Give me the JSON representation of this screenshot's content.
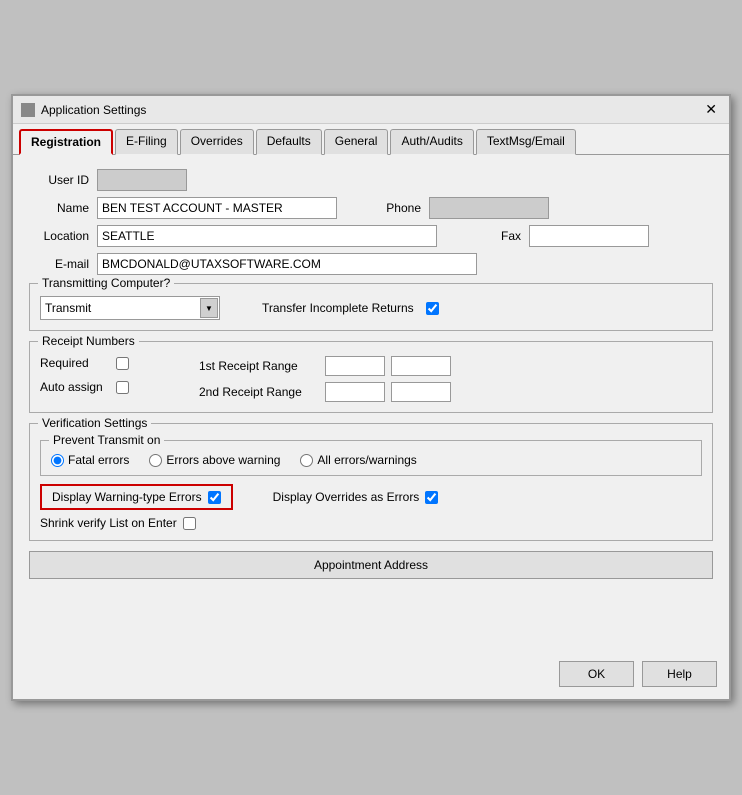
{
  "window": {
    "title": "Application Settings",
    "close_label": "✕"
  },
  "tabs": [
    {
      "id": "registration",
      "label": "Registration",
      "active": true
    },
    {
      "id": "efiling",
      "label": "E-Filing",
      "active": false
    },
    {
      "id": "overrides",
      "label": "Overrides",
      "active": false
    },
    {
      "id": "defaults",
      "label": "Defaults",
      "active": false
    },
    {
      "id": "general",
      "label": "General",
      "active": false
    },
    {
      "id": "auth-audits",
      "label": "Auth/Audits",
      "active": false
    },
    {
      "id": "textmsg-email",
      "label": "TextMsg/Email",
      "active": false
    }
  ],
  "form": {
    "userid_label": "User ID",
    "userid_value": "",
    "name_label": "Name",
    "name_value": "BEN TEST ACCOUNT - MASTER",
    "location_label": "Location",
    "location_value": "SEATTLE",
    "email_label": "E-mail",
    "email_value": "BMCDONALD@UTAXSOFTWARE.COM",
    "phone_label": "Phone",
    "phone_value": "",
    "fax_label": "Fax",
    "fax_value": ""
  },
  "transmitting": {
    "group_title": "Transmitting Computer?",
    "select_value": "Transmit",
    "select_options": [
      "Transmit"
    ],
    "transfer_label": "Transfer Incomplete Returns",
    "transfer_checked": true
  },
  "receipt_numbers": {
    "group_title": "Receipt Numbers",
    "required_label": "Required",
    "required_checked": false,
    "auto_assign_label": "Auto assign",
    "auto_assign_checked": false,
    "first_range_label": "1st Receipt Range",
    "second_range_label": "2nd Receipt Range"
  },
  "verification": {
    "group_title": "Verification Settings",
    "inner_title": "Prevent Transmit on",
    "radio_fatal_label": "Fatal errors",
    "radio_above_label": "Errors above warning",
    "radio_all_label": "All errors/warnings",
    "warning_errors_label": "Display Warning-type Errors",
    "warning_errors_checked": true,
    "display_overrides_label": "Display Overrides as Errors",
    "display_overrides_checked": true,
    "shrink_label": "Shrink verify List on Enter",
    "shrink_checked": false
  },
  "appointment": {
    "button_label": "Appointment Address"
  },
  "footer": {
    "ok_label": "OK",
    "help_label": "Help"
  }
}
